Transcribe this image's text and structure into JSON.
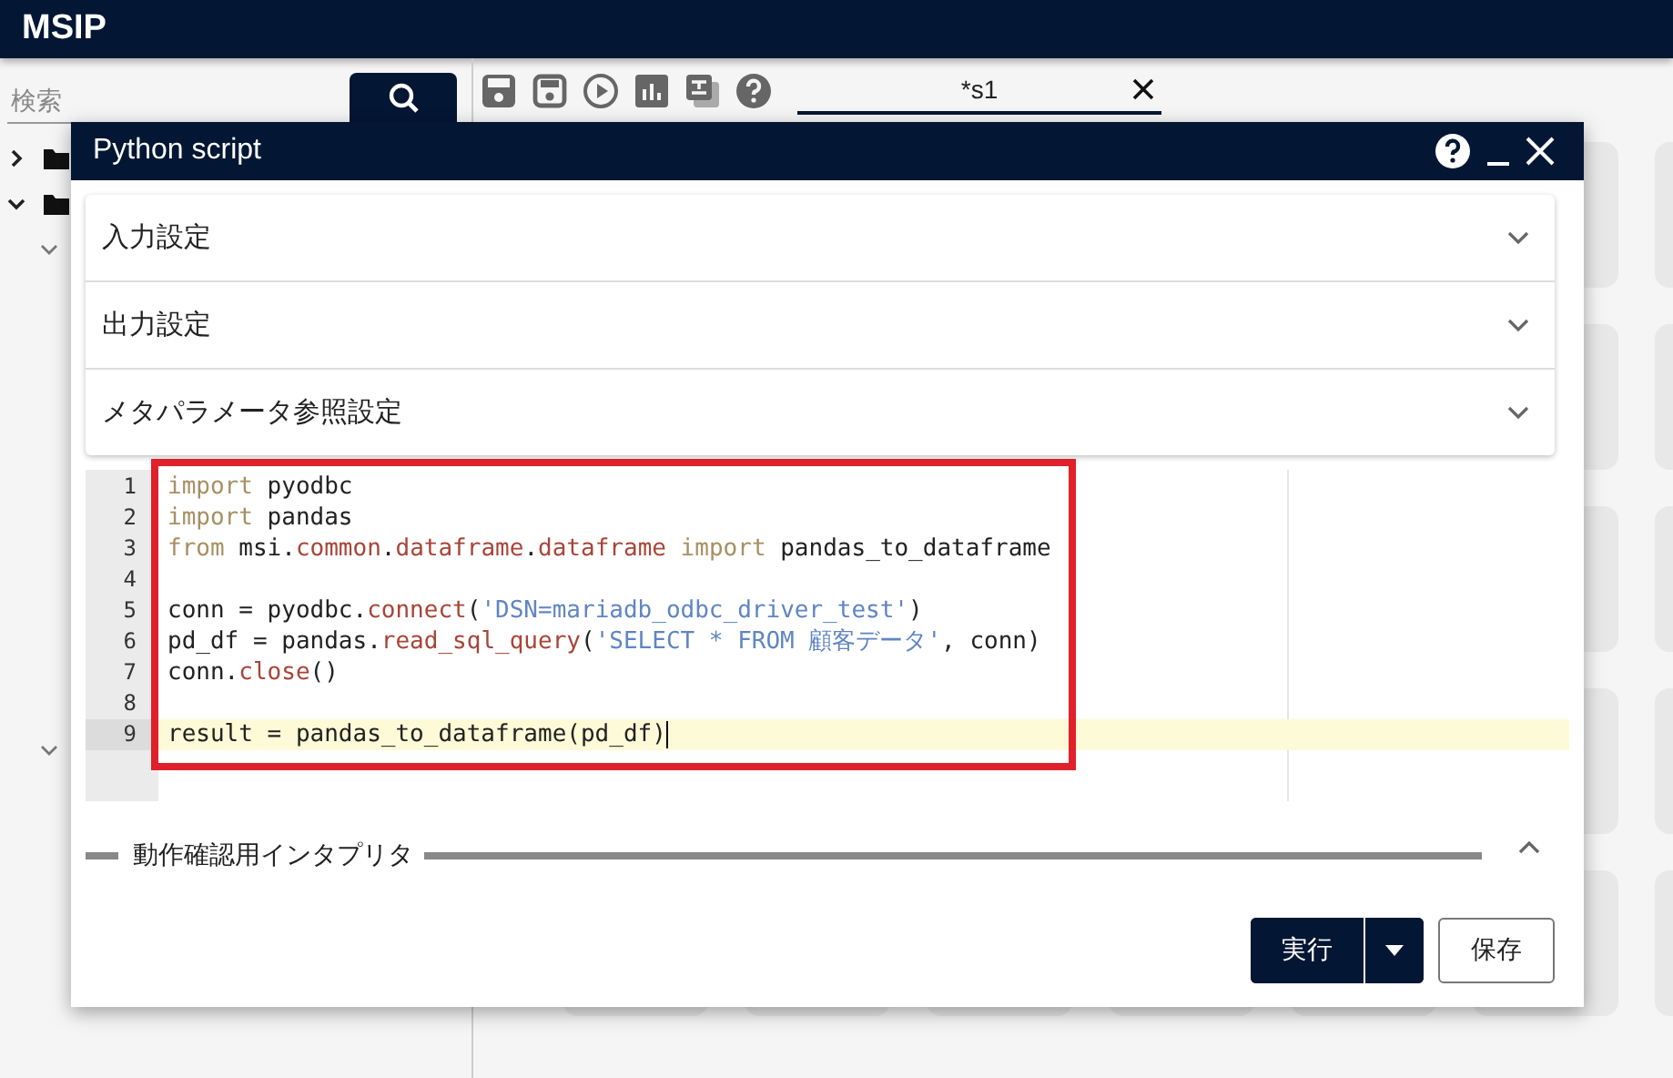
{
  "app": {
    "title": "MSIP"
  },
  "sidebar": {
    "search": {
      "placeholder": "検索"
    },
    "tree": [
      {
        "expanded": false
      },
      {
        "expanded": true,
        "children": [
          {
            "expanded": true
          },
          {
            "expanded": true
          }
        ]
      }
    ]
  },
  "tabs": [
    {
      "label": "*s1",
      "selected": true
    }
  ],
  "dialog": {
    "title": "Python script",
    "sections": [
      {
        "label": "入力設定",
        "expanded": false
      },
      {
        "label": "出力設定",
        "expanded": false
      },
      {
        "label": "メタパラメータ参照設定",
        "expanded": false
      }
    ],
    "editor": {
      "lines": [
        {
          "number": "1",
          "active": false,
          "tokens": [
            {
              "t": "import",
              "kind": "keyword"
            },
            {
              "t": " pyodbc",
              "kind": "plain"
            }
          ]
        },
        {
          "number": "2",
          "active": false,
          "tokens": [
            {
              "t": "import",
              "kind": "keyword"
            },
            {
              "t": " pandas",
              "kind": "plain"
            }
          ]
        },
        {
          "number": "3",
          "active": false,
          "tokens": [
            {
              "t": "from",
              "kind": "keyword"
            },
            {
              "t": " msi.",
              "kind": "plain"
            },
            {
              "t": "common",
              "kind": "property"
            },
            {
              "t": ".",
              "kind": "plain"
            },
            {
              "t": "dataframe",
              "kind": "property"
            },
            {
              "t": ".",
              "kind": "plain"
            },
            {
              "t": "dataframe",
              "kind": "property"
            },
            {
              "t": " import",
              "kind": "keyword"
            },
            {
              "t": " pandas_to_dataframe",
              "kind": "plain"
            }
          ]
        },
        {
          "number": "4",
          "active": false
        },
        {
          "number": "5",
          "active": false,
          "tokens": [
            {
              "t": "conn = pyodbc.",
              "kind": "plain"
            },
            {
              "t": "connect",
              "kind": "property"
            },
            {
              "t": "(",
              "kind": "plain"
            },
            {
              "t": "'DSN=mariadb_odbc_driver_test'",
              "kind": "string"
            },
            {
              "t": ")",
              "kind": "plain"
            }
          ]
        },
        {
          "number": "6",
          "active": false,
          "tokens": [
            {
              "t": "pd_df = pandas.",
              "kind": "plain"
            },
            {
              "t": "read_sql_query",
              "kind": "property"
            },
            {
              "t": "(",
              "kind": "plain"
            },
            {
              "t": "'SELECT * FROM 顧客データ'",
              "kind": "string"
            },
            {
              "t": ", conn)",
              "kind": "plain"
            }
          ]
        },
        {
          "number": "7",
          "active": false,
          "tokens": [
            {
              "t": "conn.",
              "kind": "plain"
            },
            {
              "t": "close",
              "kind": "property"
            },
            {
              "t": "()",
              "kind": "plain"
            }
          ]
        },
        {
          "number": "8",
          "active": false
        },
        {
          "number": "9",
          "active": true,
          "tokens": [
            {
              "t": "result = pandas_to_dataframe(pd_df)",
              "kind": "plain"
            }
          ]
        }
      ]
    },
    "interpreter": {
      "label": "動作確認用インタプリタ",
      "expanded": false
    },
    "buttons": [
      {
        "label": "実行",
        "kind": "split"
      },
      {
        "label": "保存",
        "kind": "outline"
      }
    ]
  }
}
